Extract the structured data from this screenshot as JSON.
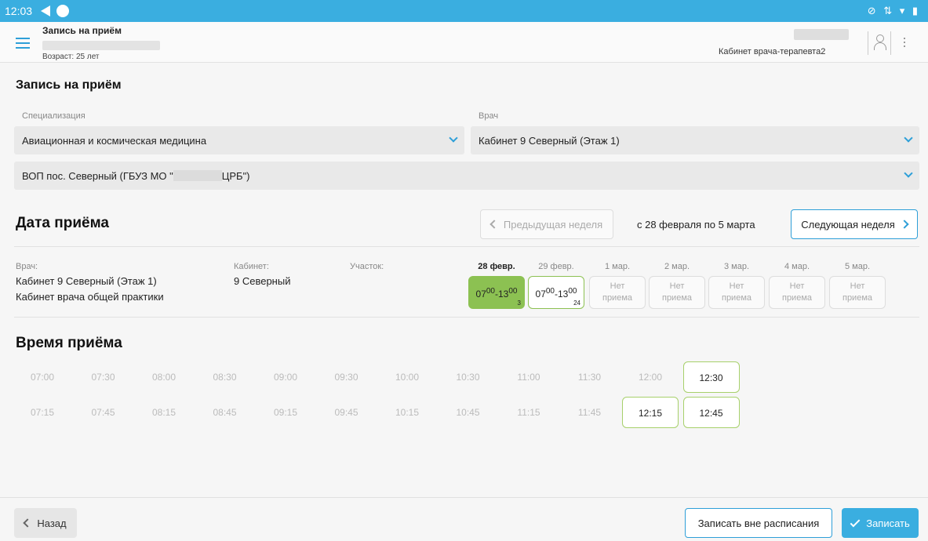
{
  "status_bar": {
    "time": "12:03",
    "icons": "⊘ ⇅ ▾ ▮"
  },
  "app_bar": {
    "title": "Запись на приём",
    "age": "Возраст: 25 лет",
    "cabinet": "Кабинет врача-терапевта2"
  },
  "booking": {
    "heading": "Запись на приём",
    "specialization_label": "Специализация",
    "specialization_value": "Авиационная и космическая медицина",
    "doctor_label": "Врач",
    "doctor_value": "Кабинет 9 Северный (Этаж 1)",
    "facility_prefix": "ВОП пос. Северный (ГБУЗ МО \"",
    "facility_suffix": "ЦРБ\")"
  },
  "date_section": {
    "heading": "Дата приёма",
    "prev_week": "Предыдущая неделя",
    "week_range": "с 28 февраля по 5 марта",
    "next_week": "Следующая неделя"
  },
  "doctor_info": {
    "doctor_label": "Врач:",
    "doctor_name": "Кабинет 9 Северный (Этаж 1)",
    "doctor_room_type": "Кабинет врача общей практики",
    "cabinet_label": "Кабинет:",
    "cabinet_value": "9 Северный",
    "district_label": "Участок:"
  },
  "days": [
    {
      "label": "28 февр.",
      "start": "07",
      "start_sup": "00",
      "end": "13",
      "end_sup": "00",
      "count": "3",
      "state": "selected"
    },
    {
      "label": "29 февр.",
      "start": "07",
      "start_sup": "00",
      "end": "13",
      "end_sup": "00",
      "count": "24",
      "state": "available"
    },
    {
      "label": "1 мар.",
      "none_line1": "Нет",
      "none_line2": "приема",
      "state": "none"
    },
    {
      "label": "2 мар.",
      "none_line1": "Нет",
      "none_line2": "приема",
      "state": "none"
    },
    {
      "label": "3 мар.",
      "none_line1": "Нет",
      "none_line2": "приема",
      "state": "none"
    },
    {
      "label": "4 мар.",
      "none_line1": "Нет",
      "none_line2": "приема",
      "state": "none"
    },
    {
      "label": "5 мар.",
      "none_line1": "Нет",
      "none_line2": "приема",
      "state": "none"
    }
  ],
  "time_section": {
    "heading": "Время приёма",
    "row1": [
      "07:00",
      "07:30",
      "08:00",
      "08:30",
      "09:00",
      "09:30",
      "10:00",
      "10:30",
      "11:00",
      "11:30",
      "12:00",
      "12:30"
    ],
    "row2": [
      "07:15",
      "07:45",
      "08:15",
      "08:45",
      "09:15",
      "09:45",
      "10:15",
      "10:45",
      "11:15",
      "11:45",
      "12:15",
      "12:45"
    ],
    "available": [
      "12:15",
      "12:30",
      "12:45"
    ]
  },
  "footer": {
    "back": "Назад",
    "outside_schedule": "Записать вне расписания",
    "book": "Записать"
  },
  "colors": {
    "accent": "#3aaee0",
    "green": "#8cc152",
    "muted": "#aaaaaa"
  }
}
